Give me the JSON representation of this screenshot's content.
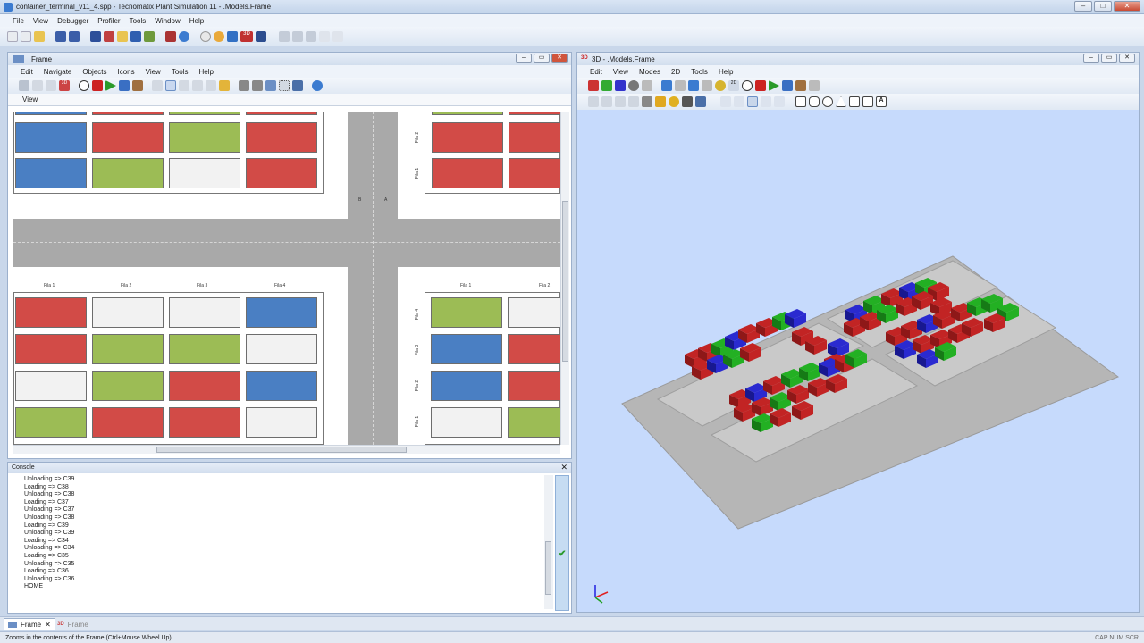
{
  "app": {
    "title": "container_terminal_v11_4.spp - Tecnomatix Plant Simulation 11 - .Models.Frame",
    "menu": [
      "File",
      "View",
      "Debugger",
      "Profiler",
      "Tools",
      "Window",
      "Help"
    ]
  },
  "frame_window": {
    "title": "Frame",
    "menu": [
      "Edit",
      "Navigate",
      "Objects",
      "Icons",
      "View",
      "Tools",
      "Help"
    ],
    "view_label": "View",
    "top_rows": [
      [
        "blue",
        "red",
        "green",
        "red"
      ],
      [
        "blue",
        "green",
        "white",
        "red"
      ]
    ],
    "top_right_rows": [
      [
        "red",
        "red"
      ],
      [
        "red",
        "red"
      ]
    ],
    "top_right_labels": [
      "Fila 2",
      "Fila 1"
    ],
    "bottom_left_labels": [
      "Fila 1",
      "Fila 2",
      "Fila 3",
      "Fila 4"
    ],
    "bottom_left_rows": [
      [
        "red",
        "white",
        "white",
        "blue"
      ],
      [
        "red",
        "green",
        "green",
        "white"
      ],
      [
        "white",
        "green",
        "red",
        "blue"
      ],
      [
        "green",
        "red",
        "red",
        "white"
      ]
    ],
    "bottom_right_labels": [
      "Fila 1",
      "Fila 2"
    ],
    "bottom_right_side_labels": [
      "Fila 4",
      "Fila 3",
      "Fila 2",
      "Fila 1"
    ],
    "bottom_right_rows": [
      [
        "green",
        "white"
      ],
      [
        "blue",
        "red"
      ],
      [
        "blue",
        "red"
      ],
      [
        "white",
        "green"
      ]
    ],
    "road_marks": [
      "A",
      "B"
    ]
  },
  "console": {
    "title": "Console",
    "lines": [
      "Unloading => C39",
      "Loading => C38",
      "Unloading => C38",
      "Loading => C37",
      "Unloading => C37",
      "Unloading => C38",
      "Loading => C39",
      "Unloading => C39",
      "Loading => C34",
      "Unloading => C34",
      "Loading => C35",
      "Unloading => C35",
      "Loading => C36",
      "Unloading => C36",
      "HOME"
    ]
  },
  "view3d": {
    "title": "3D - .Models.Frame",
    "menu": [
      "Edit",
      "View",
      "Modes",
      "2D",
      "Tools",
      "Help"
    ]
  },
  "tabs": [
    {
      "label": "Frame",
      "active": true
    },
    {
      "label": "Frame",
      "prefix": "3D",
      "active": false
    }
  ],
  "status": {
    "hint": "Zooms in the contents of the Frame (Ctrl+Mouse Wheel Up)",
    "indicators": "CAP  NUM  SCR"
  },
  "colors": {
    "red": "#d24b47",
    "blue": "#4a7fc3",
    "green": "#9cbc55",
    "white": "#f2f2f2",
    "sky": "#c6dafc"
  }
}
